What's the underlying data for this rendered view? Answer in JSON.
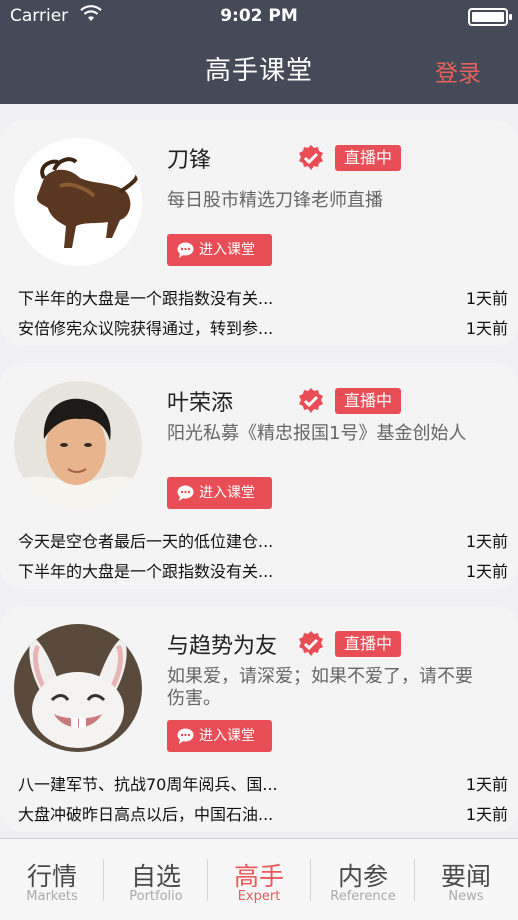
{
  "status_bar": {
    "carrier": "Carrier",
    "time": "9:02 PM"
  },
  "header": {
    "title": "高手课堂",
    "login": "登录"
  },
  "enter_label": "进入课堂",
  "cards": [
    {
      "name": "刀锋",
      "badge": "直播中",
      "desc": "每日股市精选刀锋老师直播",
      "news": [
        {
          "title": "下半年的大盘是一个跟指数没有关...",
          "time": "1天前"
        },
        {
          "title": "安倍修宪众议院获得通过，转到参...",
          "time": "1天前"
        }
      ]
    },
    {
      "name": "叶荣添",
      "badge": "直播中",
      "desc": "阳光私募《精忠报国1号》基金创始人",
      "news": [
        {
          "title": "今天是空仓者最后一天的低位建仓...",
          "time": "1天前"
        },
        {
          "title": "下半年的大盘是一个跟指数没有关...",
          "time": "1天前"
        }
      ]
    },
    {
      "name": "与趋势为友",
      "badge": "直播中",
      "desc": "如果爱，请深爱；如果不爱了，请不要伤害。",
      "news": [
        {
          "title": "八一建军节、抗战70周年阅兵、国...",
          "time": "1天前"
        },
        {
          "title": "大盘冲破昨日高点以后，中国石油...",
          "time": "1天前"
        }
      ]
    }
  ],
  "tabs": [
    {
      "cn": "行情",
      "en": "Markets"
    },
    {
      "cn": "自选",
      "en": "Portfolio"
    },
    {
      "cn": "高手",
      "en": "Expert"
    },
    {
      "cn": "内参",
      "en": "Reference"
    },
    {
      "cn": "要闻",
      "en": "News"
    }
  ],
  "active_tab": "Expert",
  "colors": {
    "header_bg": "#454a59",
    "accent_red": "#e94d55",
    "login_red": "#e8615a"
  }
}
